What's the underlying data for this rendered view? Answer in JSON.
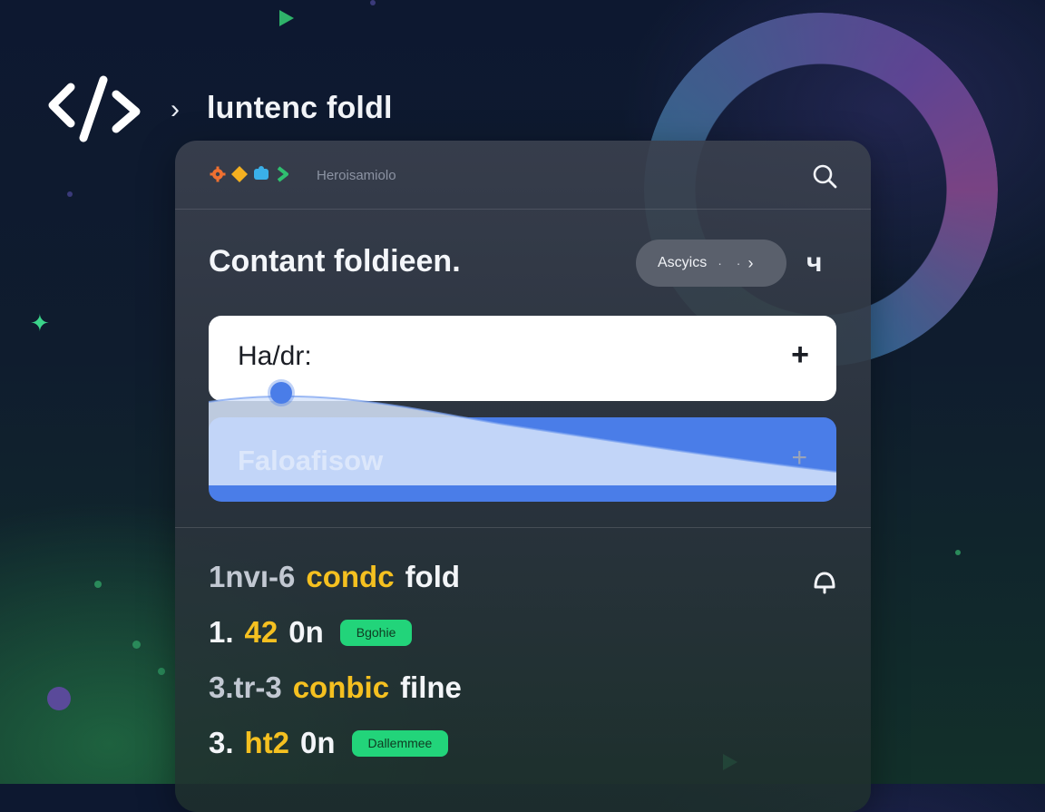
{
  "header": {
    "breadcrumb_title": "luntenc foldl",
    "breadcrumb_separator": "›"
  },
  "panel": {
    "brand_text": "Heroisamiolo",
    "brand_icons": [
      "orange-gear-icon",
      "yellow-diamond-icon",
      "cyan-puzzle-icon",
      "green-chevron-icon"
    ],
    "section_title": "Contant foldieen.",
    "pill": {
      "label": "Ascyics",
      "dots": "· ·",
      "chevron": "›"
    },
    "side_glyph": "ч",
    "card_primary": {
      "label": "Ha/dr:",
      "action": "+"
    },
    "card_secondary": {
      "label": "Faloafisow",
      "action": "+"
    },
    "rows": [
      {
        "prefix": "1nvı-6",
        "highlight": "condc",
        "suffix": "fold",
        "badge": ""
      },
      {
        "prefix": "1.",
        "highlight": "42",
        "suffix": "0n",
        "badge": "Bgohie"
      },
      {
        "prefix": "3.tr-3",
        "highlight": "conbic",
        "suffix": "filne",
        "badge": ""
      },
      {
        "prefix": "3.",
        "highlight": "ht2",
        "suffix": "0n",
        "badge": "Dallemmee"
      }
    ]
  },
  "colors": {
    "accent_blue": "#4a7de8",
    "highlight_yellow": "#f5c020",
    "badge_green": "#22d47a"
  }
}
